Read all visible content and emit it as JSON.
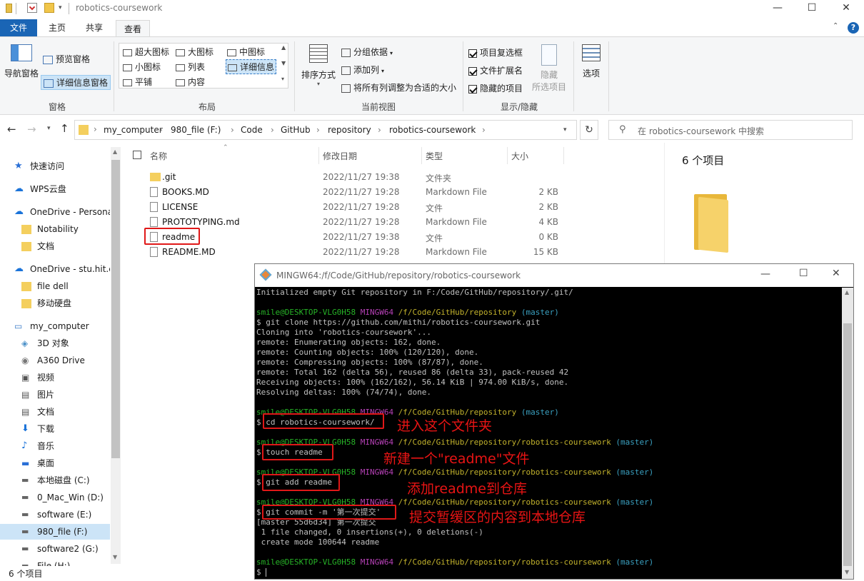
{
  "window": {
    "title": "robotics-coursework",
    "minimize": "—",
    "maximize": "☐",
    "close": "✕"
  },
  "ribbon": {
    "tabs": [
      "文件",
      "主页",
      "共享",
      "查看"
    ],
    "panes_group": {
      "nav_pane": "导航窗格",
      "preview_pane": "预览窗格",
      "details_pane": "详细信息窗格",
      "label": "窗格"
    },
    "layout_group": {
      "items": [
        "超大图标",
        "大图标",
        "中图标",
        "小图标",
        "列表",
        "详细信息",
        "平铺",
        "内容"
      ],
      "label": "布局"
    },
    "view_group": {
      "sort_by": "排序方式",
      "group_by": "分组依据",
      "add_column": "添加列",
      "fit_columns": "将所有列调整为合适的大小",
      "label": "当前视图"
    },
    "showhide_group": {
      "item_checkboxes": "项目复选框",
      "file_extensions": "文件扩展名",
      "hidden_items": "隐藏的项目",
      "hide": "隐藏",
      "hide_sub": "所选项目",
      "label": "显示/隐藏"
    },
    "options": "选项"
  },
  "address": {
    "crumbs": [
      "my_computer",
      "980_file (F:)",
      "Code",
      "GitHub",
      "repository",
      "robotics-coursework"
    ],
    "search_placeholder": "在 robotics-coursework 中搜索"
  },
  "nav": {
    "items": [
      {
        "label": "快速访问",
        "icon": "star-icon"
      },
      {
        "label": "WPS云盘",
        "icon": "cloud-icon"
      },
      {
        "label": "OneDrive - Persona",
        "icon": "cloud-icon"
      },
      {
        "label": "Notability",
        "icon": "folder-icon"
      },
      {
        "label": "文档",
        "icon": "folder-icon"
      },
      {
        "label": "OneDrive - stu.hit.e",
        "icon": "cloud-icon"
      },
      {
        "label": "file dell",
        "icon": "folder-icon"
      },
      {
        "label": "移动硬盘",
        "icon": "folder-icon"
      },
      {
        "label": "my_computer",
        "icon": "computer-icon"
      },
      {
        "label": "3D 对象",
        "icon": "cube-icon"
      },
      {
        "label": "A360 Drive",
        "icon": "drive-icon"
      },
      {
        "label": "视频",
        "icon": "video-icon"
      },
      {
        "label": "图片",
        "icon": "picture-icon"
      },
      {
        "label": "文档",
        "icon": "document-icon"
      },
      {
        "label": "下载",
        "icon": "download-icon"
      },
      {
        "label": "音乐",
        "icon": "music-icon"
      },
      {
        "label": "桌面",
        "icon": "desktop-icon"
      },
      {
        "label": "本地磁盘 (C:)",
        "icon": "disk-icon"
      },
      {
        "label": "0_Mac_Win (D:)",
        "icon": "disk-icon"
      },
      {
        "label": "software (E:)",
        "icon": "disk-icon"
      },
      {
        "label": "980_file (F:)",
        "icon": "disk-icon"
      },
      {
        "label": "software2 (G:)",
        "icon": "disk-icon"
      },
      {
        "label": "File (H:)",
        "icon": "disk-icon"
      }
    ]
  },
  "files": {
    "columns": {
      "name": "名称",
      "date": "修改日期",
      "type": "类型",
      "size": "大小"
    },
    "rows": [
      {
        "name": ".git",
        "date": "2022/11/27 19:38",
        "type": "文件夹",
        "size": "",
        "icon": "folder-icon"
      },
      {
        "name": "BOOKS.MD",
        "date": "2022/11/27 19:28",
        "type": "Markdown File",
        "size": "2 KB",
        "icon": "markdown-file-icon"
      },
      {
        "name": "LICENSE",
        "date": "2022/11/27 19:28",
        "type": "文件",
        "size": "2 KB",
        "icon": "file-icon"
      },
      {
        "name": "PROTOTYPING.md",
        "date": "2022/11/27 19:28",
        "type": "Markdown File",
        "size": "4 KB",
        "icon": "markdown-file-icon"
      },
      {
        "name": "readme",
        "date": "2022/11/27 19:38",
        "type": "文件",
        "size": "0 KB",
        "icon": "file-icon"
      },
      {
        "name": "README.MD",
        "date": "2022/11/27 19:28",
        "type": "Markdown File",
        "size": "15 KB",
        "icon": "markdown-file-icon"
      }
    ]
  },
  "preview": {
    "count": "6 个项目"
  },
  "status": {
    "count": "6 个项目"
  },
  "terminal": {
    "title": "MINGW64:/f/Code/GitHub/repository/robotics-coursework",
    "lines": [
      "Initialized empty Git repository in F:/Code/GitHub/repository/.git/",
      "",
      "P1",
      "$ git clone https://github.com/mithi/robotics-coursework.git",
      "Cloning into 'robotics-coursework'...",
      "remote: Enumerating objects: 162, done.",
      "remote: Counting objects: 100% (120/120), done.",
      "remote: Compressing objects: 100% (87/87), done.",
      "remote: Total 162 (delta 56), reused 86 (delta 33), pack-reused 42",
      "Receiving objects: 100% (162/162), 56.14 KiB | 974.00 KiB/s, done.",
      "Resolving deltas: 100% (74/74), done.",
      "",
      "P1",
      "$ cd robotics-coursework/",
      "",
      "P2",
      "$ touch readme",
      "",
      "P2",
      "$ git add readme",
      "",
      "P2",
      "$ git commit -m '第一次提交'",
      "[master 55d6d34] 第一次提交",
      " 1 file changed, 0 insertions(+), 0 deletions(-)",
      " create mode 100644 readme",
      "",
      "P2",
      "$ "
    ],
    "prompt_user": "smile@DESKTOP-VLG0H58",
    "prompt_env": "MINGW64",
    "prompt_path1": "/f/Code/GitHub/repository",
    "prompt_path2": "/f/Code/GitHub/repository/robotics-coursework",
    "prompt_branch": "(master)"
  },
  "annotations": [
    "进入这个文件夹",
    "新建一个\"readme\"文件",
    "添加readme到仓库",
    "提交暂缓区的内容到本地仓库"
  ]
}
